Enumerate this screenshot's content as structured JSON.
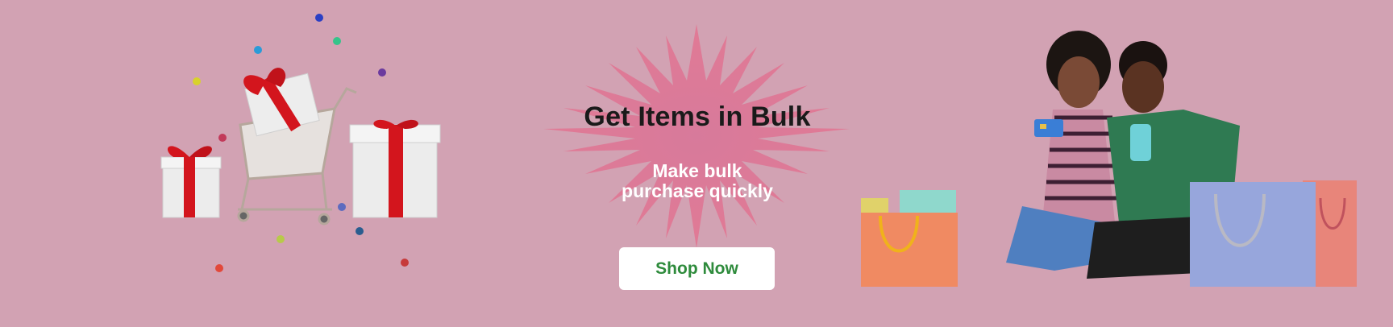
{
  "hero": {
    "headline": "Get Items in Bulk",
    "subline_line1": "Make bulk",
    "subline_line2": "purchase quickly",
    "cta_label": "Shop Now"
  },
  "colors": {
    "background": "#d2a2b3",
    "headline": "#1a1a1a",
    "subline": "#ffffff",
    "cta_background": "#ffffff",
    "cta_text": "#2e8b3c",
    "burst": "#e17a95"
  },
  "illustrations": {
    "left": "gift-boxes-and-shopping-cart",
    "right": "couple-with-shopping-bags"
  }
}
